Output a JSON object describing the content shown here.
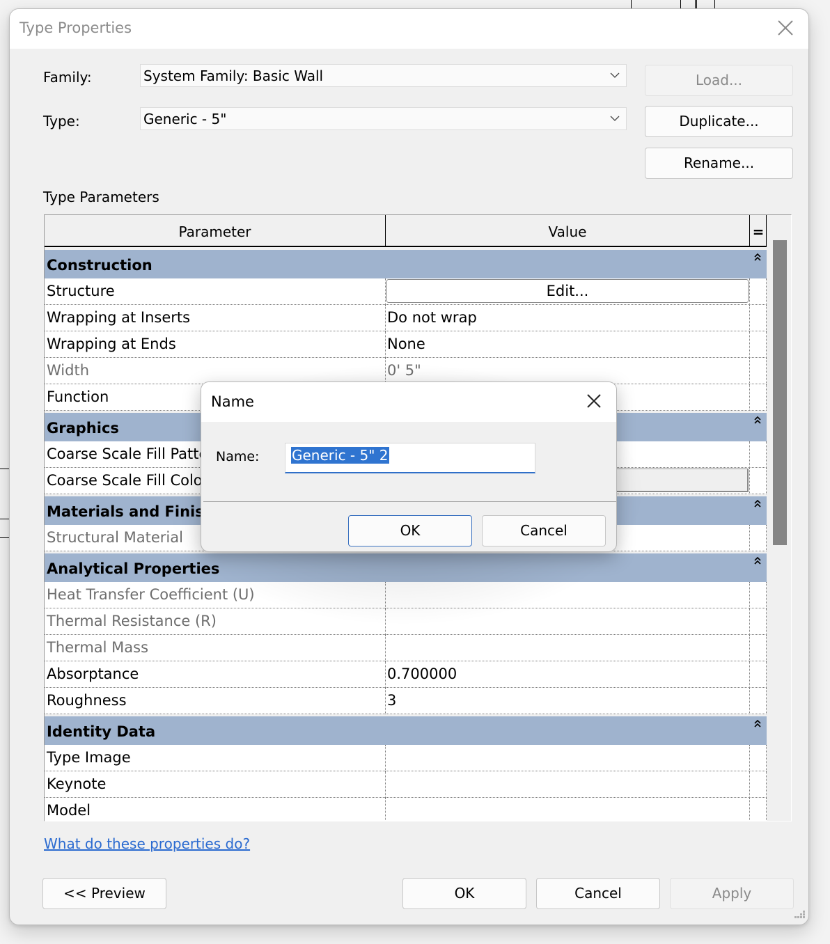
{
  "window": {
    "title": "Type Properties",
    "close_icon": "close-icon"
  },
  "family": {
    "label": "Family:",
    "value": "System Family: Basic Wall"
  },
  "type": {
    "label": "Type:",
    "value": "Generic - 5\""
  },
  "buttons": {
    "load": "Load...",
    "duplicate": "Duplicate...",
    "rename": "Rename..."
  },
  "type_parameters": {
    "heading": "Type Parameters",
    "columns": {
      "parameter": "Parameter",
      "value": "Value",
      "sort": "="
    },
    "groups": [
      {
        "name": "Construction",
        "rows": [
          {
            "param": "Structure",
            "value": "Edit...",
            "kind": "button"
          },
          {
            "param": "Wrapping at Inserts",
            "value": "Do not wrap"
          },
          {
            "param": "Wrapping at Ends",
            "value": "None"
          },
          {
            "param": "Width",
            "value": "0'  5\"",
            "readonly": true
          },
          {
            "param": "Function",
            "value": ""
          }
        ]
      },
      {
        "name": "Graphics",
        "rows": [
          {
            "param": "Coarse Scale Fill Pattern",
            "value": ""
          },
          {
            "param": "Coarse Scale Fill Color",
            "value": "",
            "kind": "color"
          }
        ]
      },
      {
        "name": "Materials and Finishes",
        "rows": [
          {
            "param": "Structural Material",
            "value": "",
            "readonly": true
          }
        ]
      },
      {
        "name": "Analytical Properties",
        "rows": [
          {
            "param": "Heat Transfer Coefficient (U)",
            "value": "",
            "readonly": true
          },
          {
            "param": "Thermal Resistance (R)",
            "value": "",
            "readonly": true
          },
          {
            "param": "Thermal Mass",
            "value": "",
            "readonly": true
          },
          {
            "param": "Absorptance",
            "value": "0.700000"
          },
          {
            "param": "Roughness",
            "value": "3"
          }
        ]
      },
      {
        "name": "Identity Data",
        "rows": [
          {
            "param": "Type Image",
            "value": ""
          },
          {
            "param": "Keynote",
            "value": ""
          },
          {
            "param": "Model",
            "value": ""
          }
        ]
      }
    ]
  },
  "help_link": "What do these properties do?",
  "footer": {
    "preview": "<< Preview",
    "ok": "OK",
    "cancel": "Cancel",
    "apply": "Apply"
  },
  "name_dialog": {
    "title": "Name",
    "label": "Name:",
    "value": "Generic - 5\" 2",
    "ok": "OK",
    "cancel": "Cancel"
  },
  "colors": {
    "group_header": "#9fb3ce",
    "link": "#2a6ad0",
    "selection": "#2f74d0"
  }
}
